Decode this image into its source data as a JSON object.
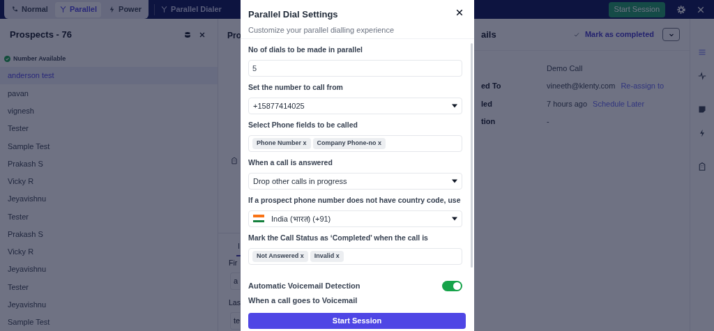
{
  "mode_tabs": [
    {
      "label": "Normal",
      "selected": false,
      "kind": "phone"
    },
    {
      "label": "Parallel",
      "selected": true,
      "kind": "fork"
    },
    {
      "label": "Power",
      "selected": false,
      "kind": "bolt"
    }
  ],
  "dialer_title": "Parallel Dialer",
  "header_button": "Start Session",
  "prospects": {
    "title": "Prospects - 76",
    "filter": "Number Available",
    "items": [
      {
        "name": "anderson test",
        "selected": true
      },
      {
        "name": "pavan",
        "selected": false
      },
      {
        "name": "vignesh",
        "selected": false
      },
      {
        "name": "Tester",
        "selected": false
      },
      {
        "name": "Sample Test",
        "selected": false
      },
      {
        "name": "Prakash S",
        "selected": false
      },
      {
        "name": "Vicky R",
        "selected": false
      },
      {
        "name": "Jeyavishnu",
        "selected": false
      },
      {
        "name": "Tester",
        "selected": false
      },
      {
        "name": "Prakash S",
        "selected": false
      },
      {
        "name": "Vicky R",
        "selected": false
      },
      {
        "name": "Jeyavishnu",
        "selected": false
      },
      {
        "name": "Tester",
        "selected": false
      },
      {
        "name": "Jeyavishnu",
        "selected": false
      },
      {
        "name": "Sample Test",
        "selected": false
      }
    ]
  },
  "middle_panel": {
    "title": "Pro",
    "tab": "I",
    "fields": [
      {
        "label": "Fir",
        "value": "a"
      },
      {
        "label": "Las",
        "value": "te"
      }
    ]
  },
  "details": {
    "title": "ails",
    "action": "Mark as completed",
    "rows": [
      {
        "value": "Demo Call"
      },
      {
        "label": "ed To",
        "value": "vineeth@klenty.com",
        "link": "Re-assign to"
      },
      {
        "label": "led",
        "value": "7 hours ago",
        "link": "Schedule Later"
      },
      {
        "label": "tion",
        "value": "-"
      }
    ]
  },
  "modal": {
    "title": "Parallel Dial Settings",
    "subtitle": "Customize your parallel dialling experience",
    "fields": [
      {
        "kind": "input",
        "label": "No of dials to be made in parallel",
        "value": "5"
      },
      {
        "kind": "select",
        "label": "Set the number to call from",
        "value": "+15877414025"
      },
      {
        "kind": "tags",
        "label": "Select Phone fields to be called",
        "tags": [
          "Phone Number x",
          "Company Phone-no x"
        ]
      },
      {
        "kind": "select",
        "label": "When a call is answered",
        "value": "Drop other calls in progress"
      },
      {
        "kind": "country",
        "label": "If a prospect phone number does not have country code, use",
        "value": "India (भारत) (+91)"
      },
      {
        "kind": "tags",
        "label": "Mark the Call Status as ‘Completed’ when the call is",
        "tags": [
          "Not Answered x",
          "Invalid x"
        ]
      }
    ],
    "toggle": {
      "label": "Automatic Voicemail Detection",
      "on": true
    },
    "note": "When a call goes to Voicemail",
    "button": "Start Session"
  }
}
